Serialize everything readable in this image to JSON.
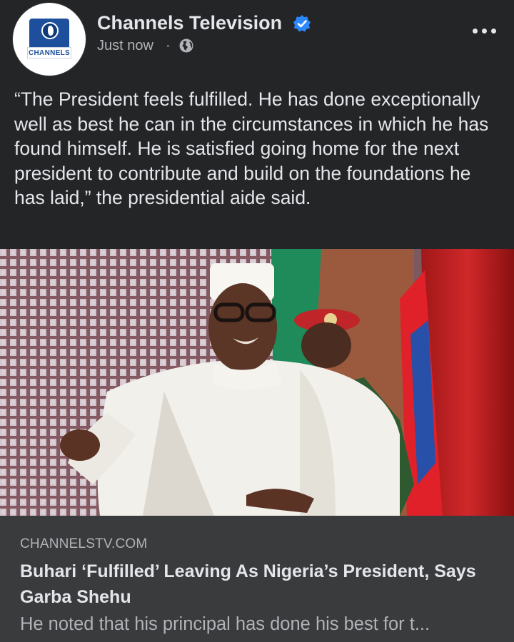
{
  "post": {
    "page_name": "Channels Television",
    "avatar_text": "CHANNELS",
    "timestamp": "Just now",
    "separator": "·",
    "privacy_icon": "globe-icon",
    "verified_icon": "verified-badge-icon",
    "more_icon": "more-options-icon",
    "text": "“The President feels fulfilled. He has done exceptionally well as best he can in the circumstances in which he has found himself. He is satisfied going home for the next president to contribute and build on the foundations he has laid,” the presidential aide said."
  },
  "link": {
    "domain": "CHANNELSTV.COM",
    "title": "Buhari ‘Fulfilled’ Leaving As Nigeria’s President, Says Garba Shehu",
    "description": "He noted that his principal has done his best for t..."
  },
  "colors": {
    "background": "#242526",
    "card": "#3a3b3c",
    "text_primary": "#e4e6eb",
    "text_secondary": "#b0b3b8",
    "verified": "#2d88ff"
  }
}
